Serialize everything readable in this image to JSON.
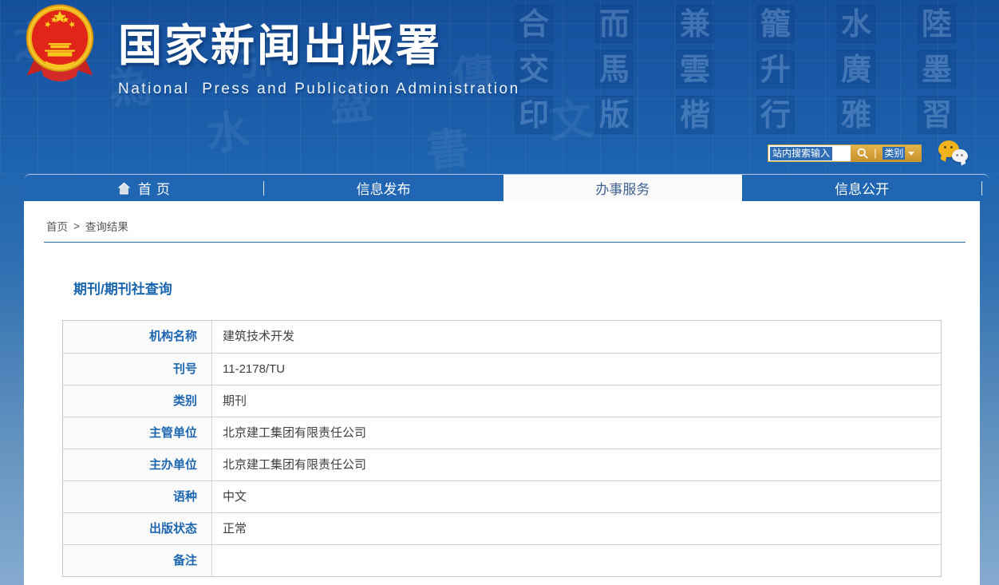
{
  "header": {
    "site_title": "国家新闻出版署",
    "site_subtitle": "National  Press and Publication Administration",
    "emblem_icon": "china-national-emblem",
    "search": {
      "input_text": "站内搜索输入",
      "search_icon": "magnifier-icon",
      "divider": "|",
      "category_label": "类别",
      "caret_icon": "chevron-down-icon"
    },
    "wechat_icon": "wechat-icon"
  },
  "nav": {
    "tabs": [
      {
        "label": "首页",
        "icon": "home-icon",
        "active": false
      },
      {
        "label": "信息发布",
        "active": false
      },
      {
        "label": "办事服务",
        "active": true
      },
      {
        "label": "信息公开",
        "active": false
      }
    ]
  },
  "breadcrumb": {
    "home": "首页",
    "separator": ">",
    "current": "查询结果"
  },
  "main": {
    "title": "期刊/期刊社查询",
    "table": {
      "rows": [
        {
          "label": "机构名称",
          "value": "建筑技术开发"
        },
        {
          "label": "刊号",
          "value": "11-2178/TU"
        },
        {
          "label": "类别",
          "value": "期刊"
        },
        {
          "label": "主管单位",
          "value": "北京建工集团有限责任公司"
        },
        {
          "label": "主办单位",
          "value": "北京建工集团有限责任公司"
        },
        {
          "label": "语种",
          "value": "中文"
        },
        {
          "label": "出版状态",
          "value": "正常"
        },
        {
          "label": "备注",
          "value": ""
        }
      ]
    }
  },
  "colors": {
    "header_blue": "#1d63af",
    "nav_blue": "#2066b2",
    "gold": "#d4a03a",
    "selection_blue": "#2e6db6",
    "title_blue": "#1a66af",
    "active_tab_text": "#3f6293",
    "table_border": "#c6c6c6",
    "value_text": "#3f3f3f",
    "breadcrumb_line": "#2d6ca8"
  },
  "texture_chars": [
    "之",
    "為",
    "水",
    "引",
    "盛",
    "書",
    "傳",
    "文",
    "合",
    "而",
    "兼",
    "籠",
    "水",
    "陸",
    "交",
    "馬",
    "雲",
    "升",
    "廣",
    "墨",
    "印",
    "版",
    "楷",
    "行",
    "雅",
    "習"
  ]
}
